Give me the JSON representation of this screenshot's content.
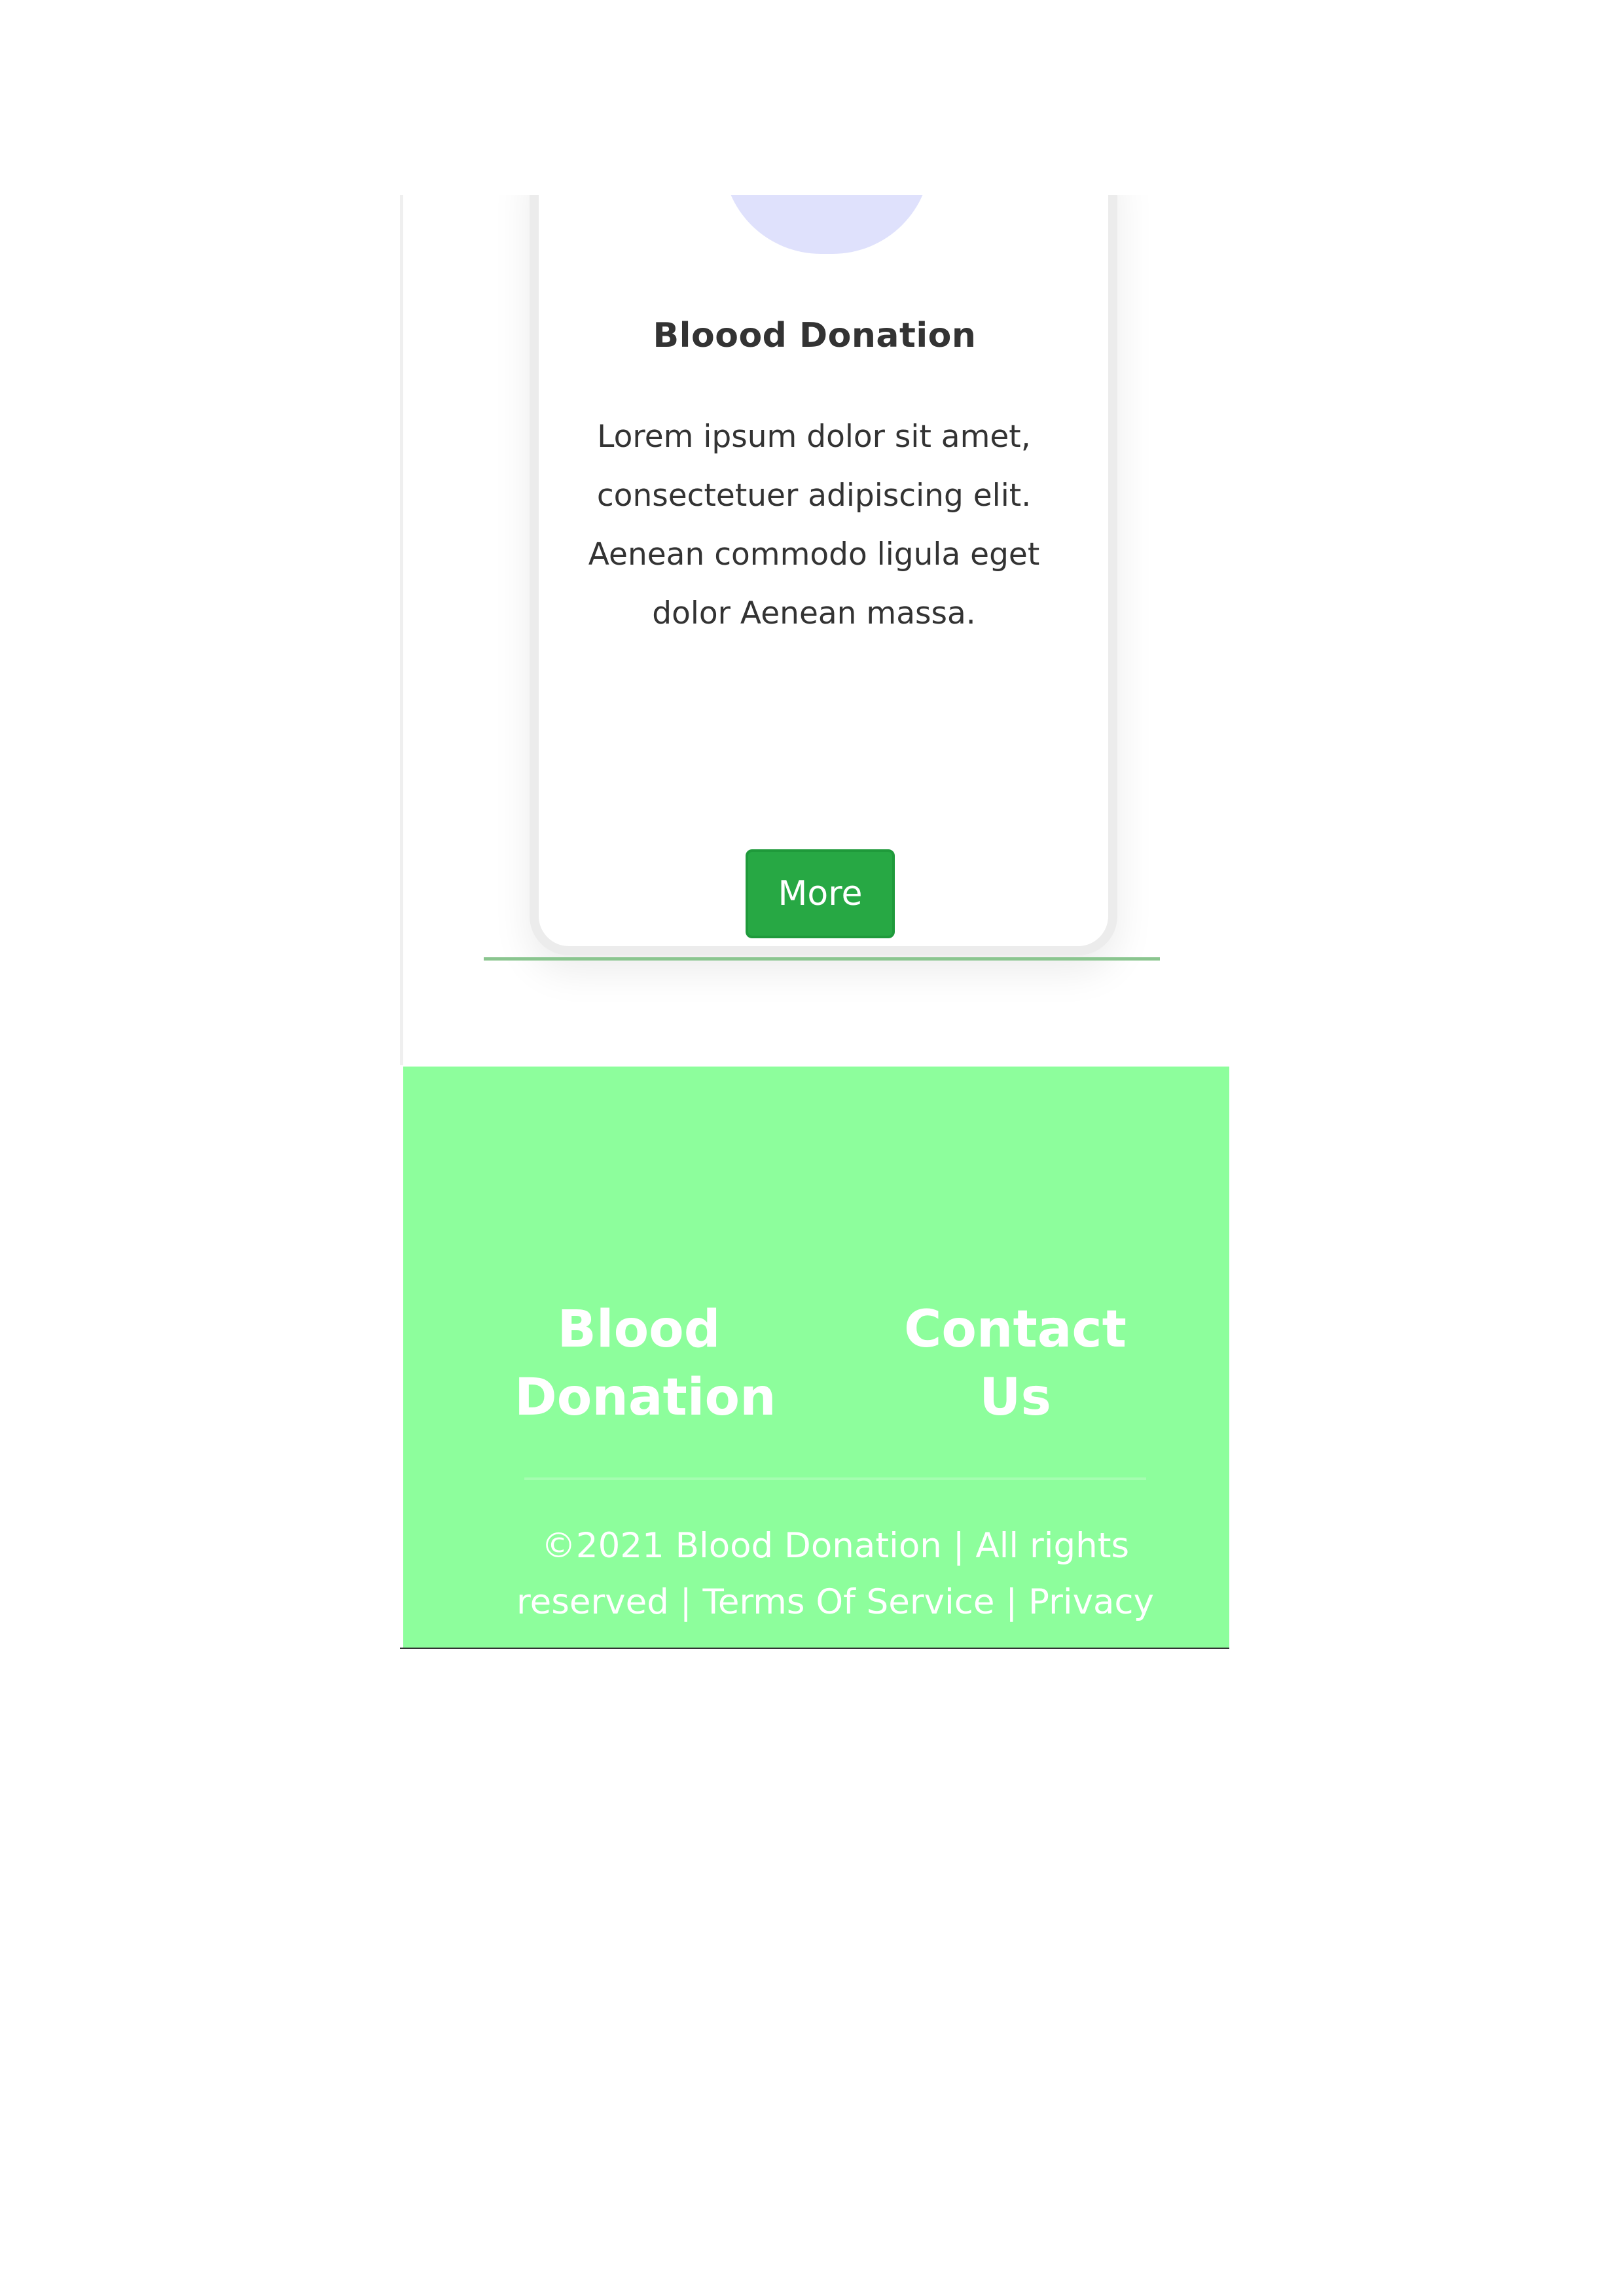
{
  "card": {
    "title": "Bloood Donation",
    "text": "Lorem ipsum dolor sit amet, consectetuer adipiscing elit. Aenean commodo ligula eget dolor Aenean massa."
  },
  "more_button": {
    "label": "More"
  },
  "footer": {
    "col_left": "Blood Donation",
    "col_right": "Contact Us",
    "copyright": "©2021 Blood Donation",
    "separator1": " | ",
    "rights": "All rights reserved",
    "separator2": " | ",
    "terms": "Terms Of Service",
    "separator3": " | ",
    "privacy": "Privacy"
  },
  "colors": {
    "accent_green": "#27a844",
    "footer_bg": "#8dfe9c",
    "icon_circle": "#dfe1fc",
    "icon_red": "#e8193b"
  },
  "icons": {
    "card_icon": "blood-drop-icon"
  }
}
